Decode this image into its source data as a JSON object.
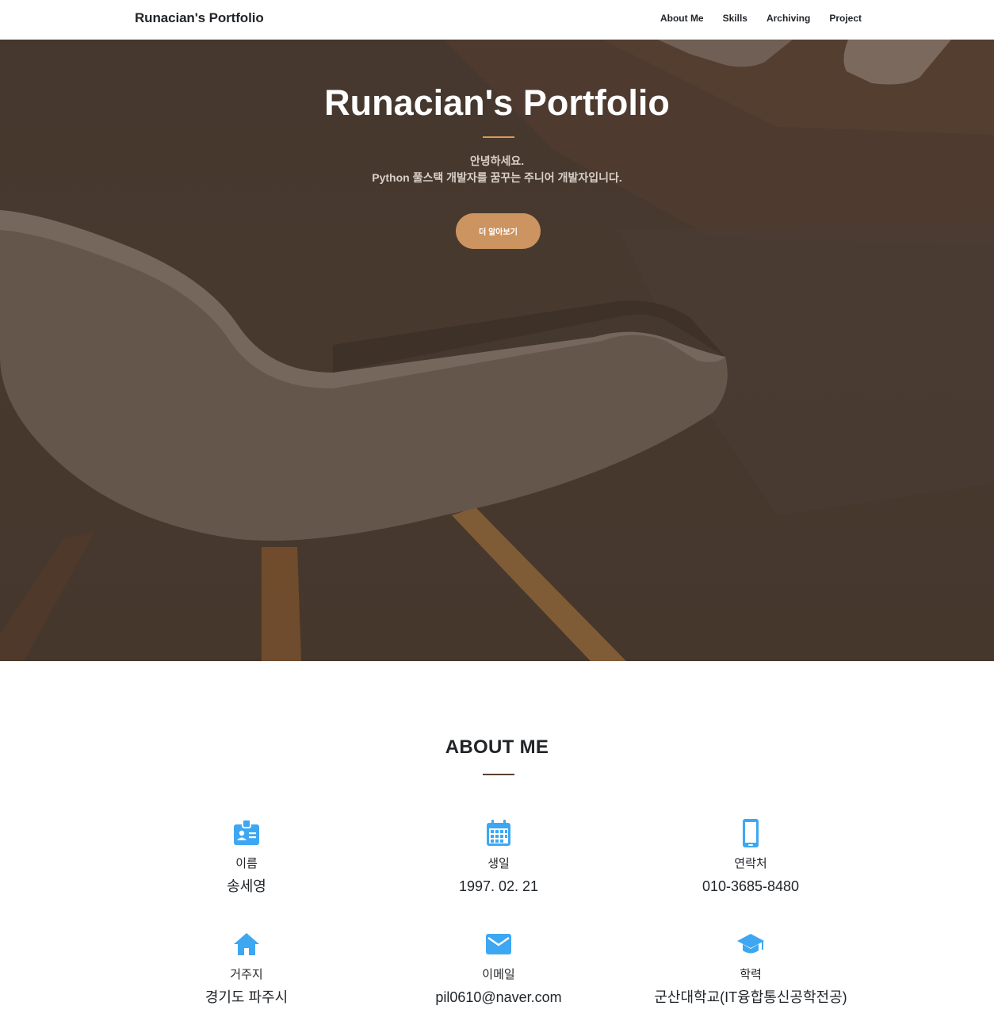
{
  "navbar": {
    "brand": "Runacian's Portfolio",
    "links": [
      "About Me",
      "Skills",
      "Archiving",
      "Project"
    ]
  },
  "hero": {
    "title": "Runacian's Portfolio",
    "subtitle_line1": "안녕하세요.",
    "subtitle_line2": "Python 풀스택 개발자를 꿈꾸는 주니어 개발자입니다.",
    "button_label": "더 알아보기"
  },
  "about": {
    "title": "ABOUT ME",
    "items": [
      {
        "icon": "id-card-icon",
        "label": "이름",
        "value": "송세영"
      },
      {
        "icon": "calendar-icon",
        "label": "생일",
        "value": "1997. 02. 21"
      },
      {
        "icon": "phone-icon",
        "label": "연락처",
        "value": "010-3685-8480"
      },
      {
        "icon": "home-icon",
        "label": "거주지",
        "value": "경기도 파주시"
      },
      {
        "icon": "mail-icon",
        "label": "이메일",
        "value": "pil0610@naver.com"
      },
      {
        "icon": "graduation-cap-icon",
        "label": "학력",
        "value": "군산대학교(IT융합통신공학전공)"
      }
    ]
  },
  "colors": {
    "accent": "#cc9460",
    "icon": "#3ea7f2",
    "hero_overlay": "#4a3b31"
  }
}
